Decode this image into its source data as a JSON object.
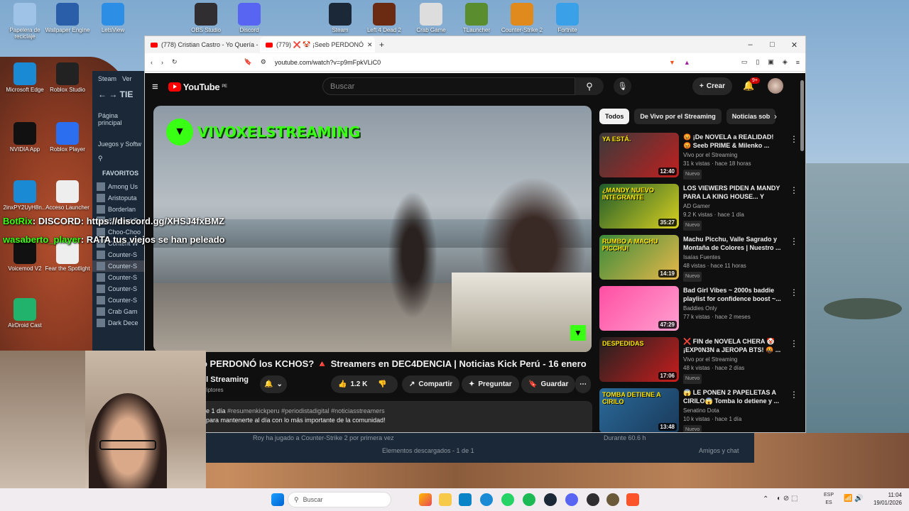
{
  "desktop": {
    "icons": [
      {
        "label": "Papelera de reciclaje",
        "icon": "recycle-bin-icon",
        "color": "#9ec3e6"
      },
      {
        "label": "Wallpaper Engine",
        "icon": "wallpaper-engine-icon",
        "color": "#2a5ea8"
      },
      {
        "label": "LetsView",
        "icon": "letsview-icon",
        "color": "#2d8ee6"
      },
      {
        "label": "OBS Studio",
        "icon": "obs-icon",
        "color": "#302e31"
      },
      {
        "label": "Discord",
        "icon": "discord-icon",
        "color": "#5865f2"
      },
      {
        "label": "Steam",
        "icon": "steam-icon",
        "color": "#1b2838"
      },
      {
        "label": "Left 4 Dead 2",
        "icon": "l4d2-icon",
        "color": "#6b2a12"
      },
      {
        "label": "Crab Game",
        "icon": "crab-game-icon",
        "color": "#dddddd"
      },
      {
        "label": "TLauncher",
        "icon": "tlauncher-icon",
        "color": "#5a8d2e"
      },
      {
        "label": "Counter-Strike 2",
        "icon": "cs2-icon",
        "color": "#e08a1e"
      },
      {
        "label": "Fortnite",
        "icon": "fortnite-icon",
        "color": "#3aa0e8"
      },
      {
        "label": "Microsoft Edge",
        "icon": "edge-icon",
        "color": "#1a8ad4"
      },
      {
        "label": "Roblox Studio",
        "icon": "roblox-studio-icon",
        "color": "#222222"
      },
      {
        "label": "NVIDIA App",
        "icon": "nvidia-icon",
        "color": "#111111"
      },
      {
        "label": "Roblox Player",
        "icon": "roblox-player-icon",
        "color": "#2b6ef0"
      },
      {
        "label": "2inxPY2UyH8n...",
        "icon": "edge-icon",
        "color": "#1a8ad4"
      },
      {
        "label": "Acceso Launcher",
        "icon": "file-icon",
        "color": "#eeeeee"
      },
      {
        "label": "Voicemod V2",
        "icon": "voicemod-icon",
        "color": "#111111"
      },
      {
        "label": "Fear the Spotlight",
        "icon": "file-icon",
        "color": "#eeeeee"
      },
      {
        "label": "AirDroid Cast",
        "icon": "airdroid-icon",
        "color": "#21b36b"
      }
    ]
  },
  "steam": {
    "brand": "Steam",
    "menu": "Ver",
    "store": "TIE",
    "home": "Página principal",
    "games": "Juegos y Softw",
    "favorites": "FAVORITOS",
    "games_list": [
      "Among Us",
      "Aristoputa",
      "Borderlan",
      "Chained To",
      "Choo-Choo",
      "Content W",
      "Counter-S",
      "Counter-S",
      "Counter-S",
      "Counter-S",
      "Counter-S",
      "Crab Gam",
      "Dark Dece"
    ],
    "activity": "Roy ha jugado a",
    "activity_game": "Counter-Strike 2",
    "activity_suffix": "por primera vez",
    "downloads": "Elementos descargados - 1 de 1",
    "friends": "Amigos y chat",
    "duration": "Durante 60.6 h"
  },
  "browser": {
    "tabs": [
      {
        "title": "(778) Cristian Castro - Yo Quería - Yo"
      },
      {
        "title": "(779) ❌ 🤡 ¡Seeb PERDONÓ"
      }
    ],
    "new_tab": "+",
    "url": "youtube.com/watch?v=p9mFpkVLiC0",
    "controls": {
      "minimize": "–",
      "maximize": "□",
      "close": "✕"
    }
  },
  "youtube": {
    "logo": "YouTube",
    "region": "PE",
    "search_placeholder": "Buscar",
    "create": "Crear",
    "notifications": "9+",
    "channel_overlay": "VIVOXELSTREAMING",
    "video_title": "o PERDONÓ los KCHOS? 🔺 Streamers en DEC4DENCIA | Noticias Kick Perú - 16 enero",
    "channel": "el Streaming",
    "subscribers": "criptores",
    "likes": "1.2 K",
    "share": "Compartir",
    "ask": "Preguntar",
    "save": "Guardar",
    "desc_meta": "e 1 día",
    "desc_tags": "#resumenkickperu #periodistadigital #noticiasstreamers",
    "desc_text": "para mantenerte al día con lo más importante de la comunidad!",
    "chips": [
      "Todos",
      "De Vivo por el Streaming",
      "Noticias sob"
    ],
    "recommendations": [
      {
        "title": "😡 ¡De NOVELA a REALIDAD! 😡 Seeb PRIME & Milenko ...",
        "channel": "Vivo por el Streaming",
        "views": "31 k vistas · hace 18 horas",
        "badge": "Nuevo",
        "duration": "12:40",
        "thumb_text": "YA ESTÁ.",
        "c1": "#3a3a3a",
        "c2": "#c02020"
      },
      {
        "title": "LOS VIEWERS PIDEN A MANDY PARA LA KING HOUSE... Y TEK...",
        "channel": "AD Gamer",
        "views": "9.2 K vistas · hace 1 día",
        "badge": "Nuevo",
        "duration": "35:27",
        "thumb_text": "¿MANDY NUEVO INTEGRANTE",
        "c1": "#1e5a2a",
        "c2": "#d8d020"
      },
      {
        "title": "Machu Picchu, Valle Sagrado y Montaña de Colores | Nuestro ...",
        "channel": "Isaías Fuentes",
        "views": "48 vistas · hace 11 horas",
        "badge": "Nuevo",
        "duration": "14:19",
        "thumb_text": "RUMBO A MACHU PICCHU!",
        "c1": "#3a8a3a",
        "c2": "#e6b84a"
      },
      {
        "title": "Bad Girl Vibes ~ 2000s baddie playlist for confidence boost ~...",
        "channel": "Baddies Only",
        "views": "77 k vistas · hace 2 meses",
        "badge": "",
        "duration": "47:29",
        "thumb_text": "",
        "c1": "#ff4fa3",
        "c2": "#ff9fd0"
      },
      {
        "title": "❌ FIN de NOVELA CHERA 🤡 ¡EXP0N3N a JEROPA BTS! 🤬 ...",
        "channel": "Vivo por el Streaming",
        "views": "48 k vistas · hace 2 días",
        "badge": "Nuevo",
        "duration": "17:06",
        "thumb_text": "DESPEDIDAS",
        "c1": "#202020",
        "c2": "#c81e1e"
      },
      {
        "title": "😱 LE PONEN 2 PAPELETAS A CIRILO😱 Tomba lo detiene y ...",
        "channel": "Senatino Dota",
        "views": "10 k vistas · hace 1 día",
        "badge": "Nuevo",
        "duration": "13:48",
        "thumb_text": "TOMBA DETIENE A CIRILO",
        "c1": "#2a6a9a",
        "c2": "#1a3a5a"
      }
    ]
  },
  "overlay_chat": [
    {
      "user": "BotRix",
      "text": ": DISCORD: https://discord.gg/XHSJ4fxBMZ",
      "color": "#39ff14"
    },
    {
      "user": "wasaberto_player",
      "text": ": RATA tus viejos se han peleado",
      "color": "#39ff14"
    }
  ],
  "taskbar": {
    "search": "Buscar",
    "lang1": "ESP",
    "lang2": "ES",
    "time": "11:04",
    "date": "19/01/2026"
  }
}
